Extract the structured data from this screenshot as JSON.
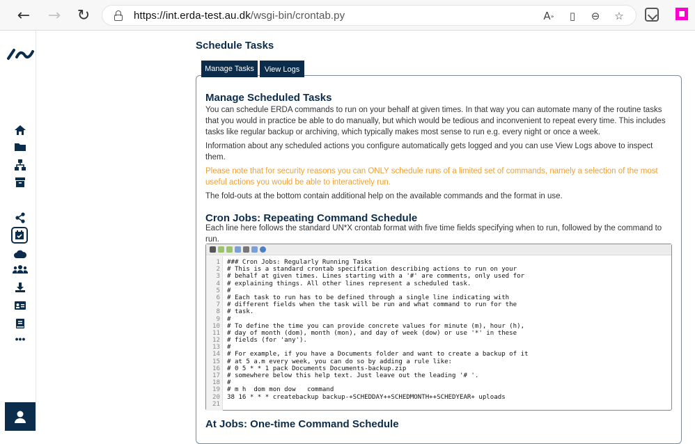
{
  "browser": {
    "url_host": "https://int.erda-test.au.dk",
    "url_path": "/wsgi-bin/crontab.py",
    "icons": [
      "back-icon",
      "forward-icon",
      "reload-icon",
      "lock-icon",
      "read-aloud-icon",
      "immersive-reader-icon",
      "zoom-icon",
      "add-favorite-icon",
      "extension-icon",
      "profile-icon"
    ]
  },
  "sidebar": {
    "items": [
      "home-icon",
      "folder-icon",
      "sitemap-icon",
      "archive-icon",
      "share-icon",
      "calendar-check-icon",
      "cloud-icon",
      "users-icon",
      "download-icon",
      "id-card-icon",
      "book-icon",
      "more-icon",
      "user-icon"
    ],
    "active": "calendar-check-icon"
  },
  "page": {
    "title": "Schedule Tasks",
    "tabs": [
      "Manage Tasks",
      "View Logs"
    ],
    "manage_heading": "Manage Scheduled Tasks",
    "intro": "You can schedule ERDA commands to run on your behalf at given times. In that way you can automate many of the routine tasks that you would in practice be able to do manually, but which would be tedious and inconvenient to repeat every time. This includes tasks like regular backup or archiving, which typically makes most sense to run e.g. every night or once a week.",
    "logs_info": "Information about any scheduled actions you configure automatically gets logged and you can use View Logs above to inspect them.",
    "security_note": "Please note that for security reasons you can ONLY schedule runs of a limited set of commands, namely a selection of the most useful actions you would be able to interactively run.",
    "foldout_note": "The fold-outs at the bottom contain additional help on the available commands and the format in use.",
    "cron_heading": "Cron Jobs: Repeating Command Schedule",
    "cron_desc": "Each line here follows the standard UN*X crontab format with five time fields specifying when to run, followed by the command to run.",
    "at_heading": "At Jobs: One-time Command Schedule"
  },
  "editor": {
    "lines": [
      "### Cron Jobs: Regularly Running Tasks",
      "# This is a standard crontab specification describing actions to run on your",
      "# behalf at given times. Lines starting with a '#' are comments, only used for",
      "# explaining things. All other lines represent a scheduled task.",
      "#",
      "# Each task to run has to be defined through a single line indicating with",
      "# different fields when the task will be run and what command to run for the",
      "# task.",
      "#",
      "# To define the time you can provide concrete values for minute (m), hour (h),",
      "# day of month (dom), month (mon), and day of week (dow) or use '*' in these",
      "# fields (for 'any').",
      "#",
      "# For example, if you have a Documents folder and want to create a backup of it",
      "# at 5 a.m every week, you can do so by adding a rule like:",
      "# 0 5 * * 1 pack Documents Documents-backup.zip",
      "# somewhere below this help text. Just leave out the leading '# '.",
      "#",
      "# m h  dom mon dow   command",
      "38 16 * * * createbackup backup-+SCHEDDAY++SCHEDMONTH++SCHEDYEAR+ uploads",
      ""
    ]
  },
  "colors": {
    "navy": "#0b2c4a",
    "orange": "#f0a030",
    "magenta": "#ff00d4"
  }
}
